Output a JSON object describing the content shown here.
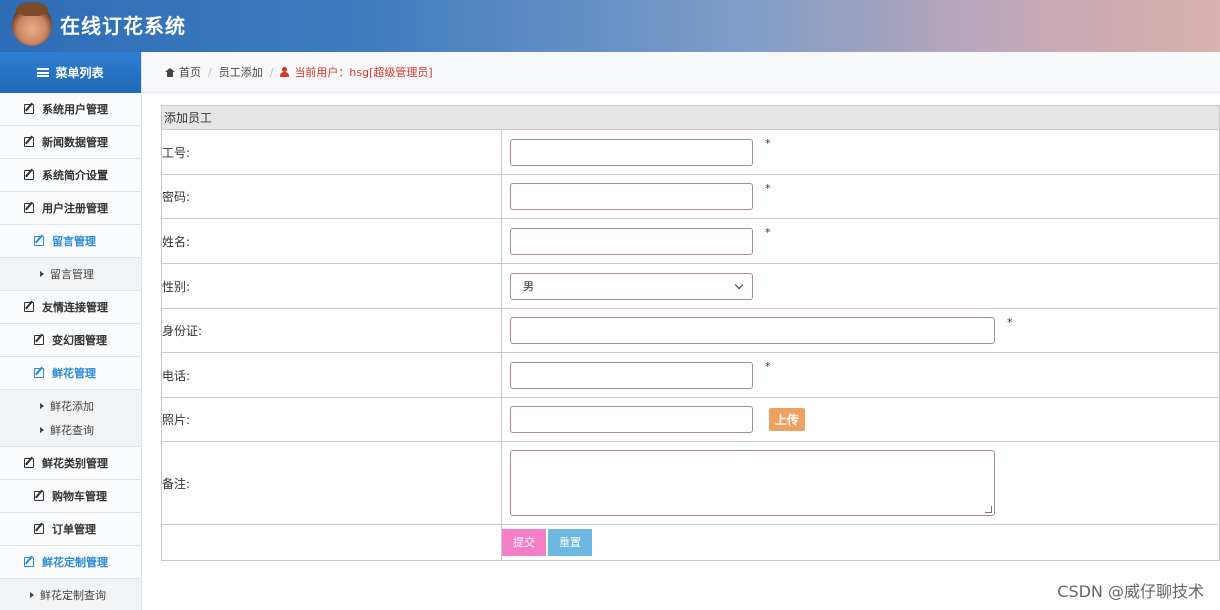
{
  "header": {
    "title": "在线订花系统"
  },
  "sidebar": {
    "head": "菜单列表",
    "items": [
      {
        "label": "系统用户管理"
      },
      {
        "label": "新闻数据管理"
      },
      {
        "label": "系统简介设置"
      },
      {
        "label": "用户注册管理"
      },
      {
        "label": "留言管理"
      },
      {
        "label": "留言管理"
      },
      {
        "label": "友情连接管理"
      },
      {
        "label": "变幻图管理"
      },
      {
        "label": "鲜花管理"
      },
      {
        "label": "鲜花添加"
      },
      {
        "label": "鲜花查询"
      },
      {
        "label": "鲜花类别管理"
      },
      {
        "label": "购物车管理"
      },
      {
        "label": "订单管理"
      },
      {
        "label": "鲜花定制管理"
      },
      {
        "label": "鲜花定制查询"
      }
    ]
  },
  "breadcrumb": {
    "home": "首页",
    "page": "员工添加",
    "current_user": "当前用户：hsg[超级管理员]"
  },
  "form": {
    "title": "添加员工",
    "fields": [
      {
        "label": "工号:",
        "value": "",
        "required": "*"
      },
      {
        "label": "密码:",
        "value": "",
        "required": "*"
      },
      {
        "label": "姓名:",
        "value": "",
        "required": "*"
      },
      {
        "label": "性别:",
        "selected": "男"
      },
      {
        "label": "身份证:",
        "value": "",
        "required": "*"
      },
      {
        "label": "电话:",
        "value": "",
        "required": "*"
      },
      {
        "label": "照片:",
        "value": "",
        "upload": "上传"
      },
      {
        "label": "备注:",
        "value": ""
      }
    ],
    "submit": "提交",
    "reset": "重置"
  },
  "watermark": "CSDN @威仔聊技术"
}
